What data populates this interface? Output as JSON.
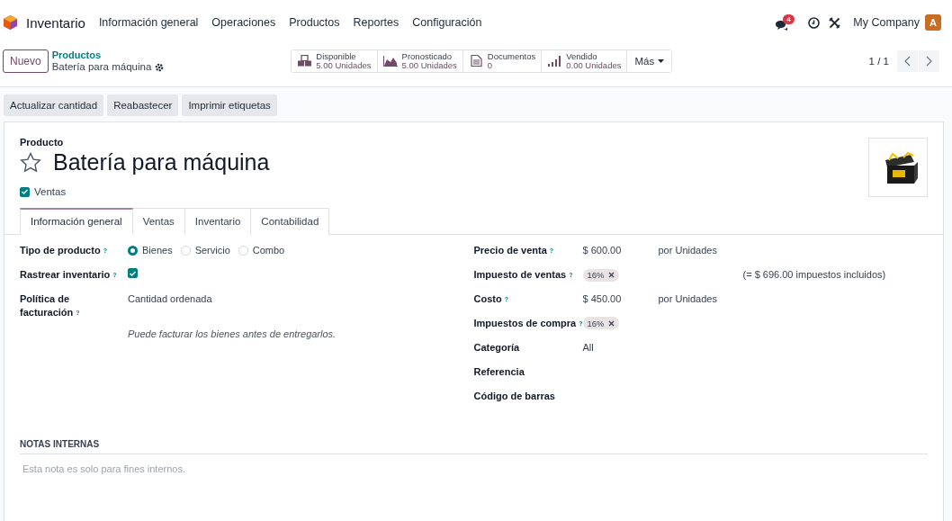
{
  "topbar": {
    "app_name": "Inventario",
    "menu": [
      "Información general",
      "Operaciones",
      "Productos",
      "Reportes",
      "Configuración"
    ],
    "message_count": "4",
    "company": "My Company",
    "avatar": "A"
  },
  "control_panel": {
    "new_button": "Nuevo",
    "breadcrumb": "Productos",
    "record": "Batería para máquina",
    "stats": [
      {
        "kind": "boxes",
        "label": "Disponible",
        "value": "5.00 Unidades"
      },
      {
        "kind": "area",
        "label": "Pronosticado",
        "value": "5.00 Unidades"
      },
      {
        "kind": "document",
        "label": "Documentos",
        "value": "0"
      },
      {
        "kind": "bars",
        "label": "Vendido",
        "value": "0.00 Unidades"
      }
    ],
    "more": "Más",
    "pager": "1 / 1"
  },
  "actions": [
    "Actualizar cantidad",
    "Reabastecer",
    "Imprimir etiquetas"
  ],
  "form": {
    "type_label": "Producto",
    "name": "Batería para máquina",
    "favorite": false,
    "sales_option": {
      "label": "Ventas",
      "checked": true
    },
    "tabs": [
      {
        "label": "Información general",
        "selected": true
      },
      {
        "label": "Ventas",
        "selected": false
      },
      {
        "label": "Inventario",
        "selected": false
      },
      {
        "label": "Contabilidad",
        "selected": false
      }
    ],
    "left_fields": [
      {
        "kind": "radio",
        "label": "Tipo de producto",
        "help": "?",
        "options": [
          {
            "label": "Bienes",
            "selected": true
          },
          {
            "label": "Servicio",
            "selected": false
          },
          {
            "label": "Combo",
            "selected": false
          }
        ]
      },
      {
        "kind": "checkbox",
        "label": "Rastrear inventario",
        "help": "?",
        "checked": true
      },
      {
        "kind": "text",
        "label": "Política de facturación",
        "help": "?",
        "value": "Cantidad ordenada",
        "note": "Puede facturar los bienes antes de entregarlos."
      }
    ],
    "right_fields": [
      {
        "kind": "money",
        "label": "Precio de venta",
        "help": "?",
        "value": "$ 600.00",
        "unit": "por Unidades"
      },
      {
        "kind": "tags",
        "label": "Impuesto de ventas",
        "help": "?",
        "tags": [
          "16%"
        ],
        "extra": "(= $ 696.00 impuestos incluidos)"
      },
      {
        "kind": "money",
        "label": "Costo",
        "help": "?",
        "value": "$ 450.00",
        "unit": "por Unidades"
      },
      {
        "kind": "tags",
        "label": "Impuestos de compra",
        "help": "?",
        "tags": [
          "16%"
        ]
      },
      {
        "kind": "text",
        "label": "Categoría",
        "value": "All"
      },
      {
        "kind": "text",
        "label": "Referencia"
      },
      {
        "kind": "text",
        "label": "Código de barras"
      }
    ],
    "notes": {
      "title": "NOTAS INTERNAS",
      "placeholder": "Esta nota es solo para fines internos."
    }
  }
}
